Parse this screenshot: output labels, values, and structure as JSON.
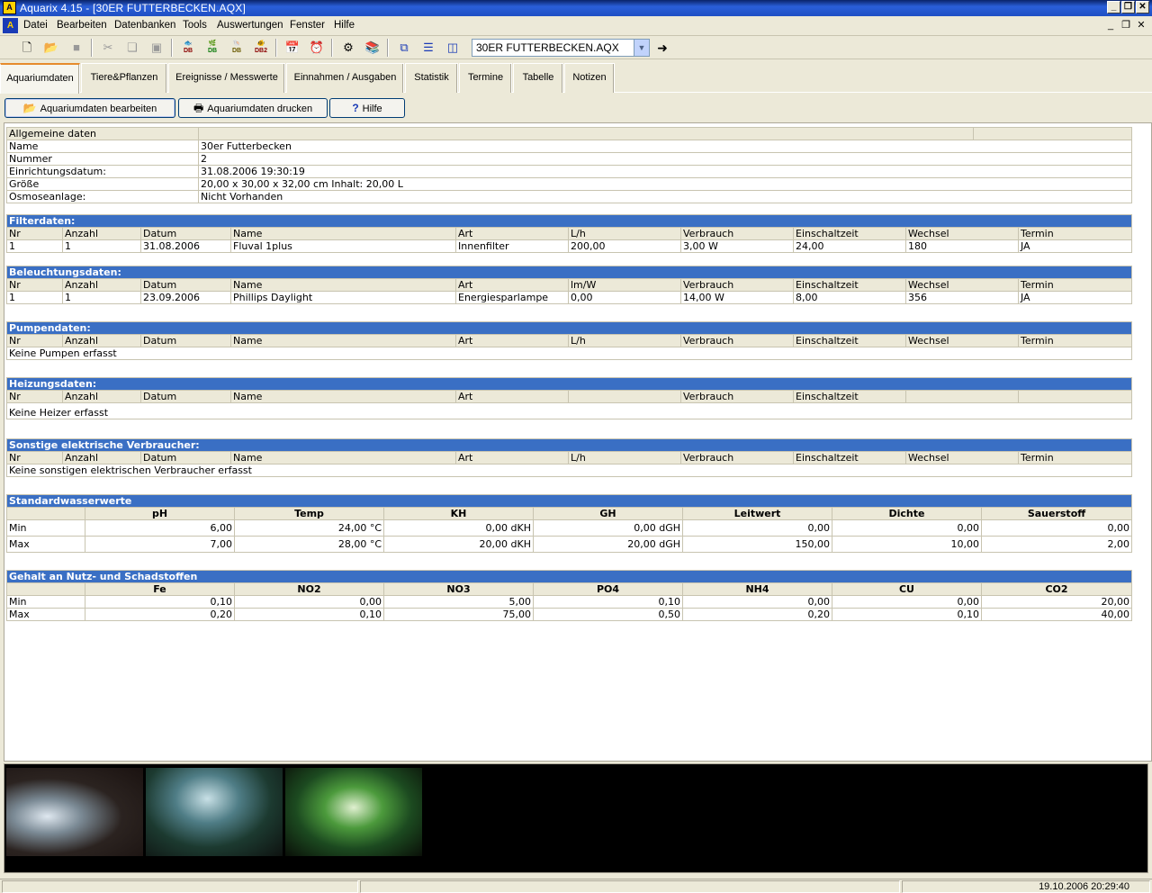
{
  "window": {
    "title": "Aquarix 4.15 - [30ER FUTTERBECKEN.AQX]",
    "app_icon": "aquarium-app-icon"
  },
  "menu": [
    "Datei",
    "Bearbeiten",
    "Datenbanken",
    "Tools",
    "Auswertungen",
    "Fenster",
    "Hilfe"
  ],
  "toolbar": {
    "file_combo_value": "30ER FUTTERBECKEN.AQX",
    "db_labels": [
      "DB",
      "DB",
      "DB",
      "DB2"
    ]
  },
  "tabs": [
    "Aquariumdaten",
    "Tiere&Pflanzen",
    "Ereignisse / Messwerte",
    "Einnahmen / Ausgaben",
    "Statistik",
    "Termine",
    "Tabelle",
    "Notizen"
  ],
  "actions": {
    "edit": "Aquariumdaten bearbeiten",
    "print": "Aquariumdaten drucken",
    "help": "Hilfe"
  },
  "general": {
    "header": "Allgemeine daten",
    "rows": [
      [
        "Name",
        "30er Futterbecken"
      ],
      [
        "Nummer",
        "2"
      ],
      [
        "Einrichtungsdatum:",
        "31.08.2006 19:30:19"
      ],
      [
        "Größe",
        "20,00 x 30,00 x 32,00 cm Inhalt: 20,00 L"
      ],
      [
        "Osmoseanlage:",
        "Nicht Vorhanden"
      ]
    ]
  },
  "filter": {
    "title": "Filterdaten:",
    "cols": [
      "Nr",
      "Anzahl",
      "Datum",
      "Name",
      "Art",
      "L/h",
      "Verbrauch",
      "Einschaltzeit",
      "Wechsel",
      "Termin"
    ],
    "rows": [
      [
        "1",
        "1",
        "31.08.2006",
        "Fluval 1plus",
        "Innenfilter",
        "200,00",
        "3,00 W",
        "24,00",
        "180",
        "JA"
      ]
    ]
  },
  "light": {
    "title": "Beleuchtungsdaten:",
    "cols": [
      "Nr",
      "Anzahl",
      "Datum",
      "Name",
      "Art",
      "lm/W",
      "Verbrauch",
      "Einschaltzeit",
      "Wechsel",
      "Termin"
    ],
    "rows": [
      [
        "1",
        "1",
        "23.09.2006",
        "Phillips Daylight",
        "Energiesparlampe",
        "0,00",
        "14,00 W",
        "8,00",
        "356",
        "JA"
      ]
    ]
  },
  "pumps": {
    "title": "Pumpendaten:",
    "cols": [
      "Nr",
      "Anzahl",
      "Datum",
      "Name",
      "Art",
      "L/h",
      "Verbrauch",
      "Einschaltzeit",
      "Wechsel",
      "Termin"
    ],
    "empty": "Keine Pumpen erfasst"
  },
  "heater": {
    "title": "Heizungsdaten:",
    "cols": [
      "Nr",
      "Anzahl",
      "Datum",
      "Name",
      "Art",
      "",
      "Verbrauch",
      "Einschaltzeit",
      "",
      ""
    ],
    "empty": "Keine Heizer erfasst"
  },
  "other": {
    "title": "Sonstige elektrische Verbraucher:",
    "cols": [
      "Nr",
      "Anzahl",
      "Datum",
      "Name",
      "Art",
      "L/h",
      "Verbrauch",
      "Einschaltzeit",
      "Wechsel",
      "Termin"
    ],
    "empty": "Keine sonstigen elektrischen Verbraucher erfasst"
  },
  "water": {
    "title": "Standardwasserwerte",
    "cols": [
      "",
      "pH",
      "Temp",
      "KH",
      "GH",
      "Leitwert",
      "Dichte",
      "Sauerstoff"
    ],
    "rows": [
      [
        "Min",
        "6,00",
        "24,00 °C",
        "0,00 dKH",
        "0,00 dGH",
        "0,00",
        "0,00",
        "0,00"
      ],
      [
        "Max",
        "7,00",
        "28,00 °C",
        "20,00 dKH",
        "20,00 dGH",
        "150,00",
        "10,00",
        "2,00"
      ]
    ]
  },
  "nutrients": {
    "title": "Gehalt an Nutz- und Schadstoffen",
    "cols": [
      "",
      "Fe",
      "NO2",
      "NO3",
      "PO4",
      "NH4",
      "CU",
      "CO2"
    ],
    "rows": [
      [
        "Min",
        "0,10",
        "0,00",
        "5,00",
        "0,10",
        "0,00",
        "0,00",
        "20,00"
      ],
      [
        "Max",
        "0,20",
        "0,10",
        "75,00",
        "0,50",
        "0,20",
        "0,10",
        "40,00"
      ]
    ]
  },
  "status": {
    "datetime": "19.10.2006 20:29:40"
  },
  "colors": {
    "section_header": "#3a6fc4",
    "titlebar": "#2a5fd8",
    "window_bg": "#ece9d8"
  }
}
